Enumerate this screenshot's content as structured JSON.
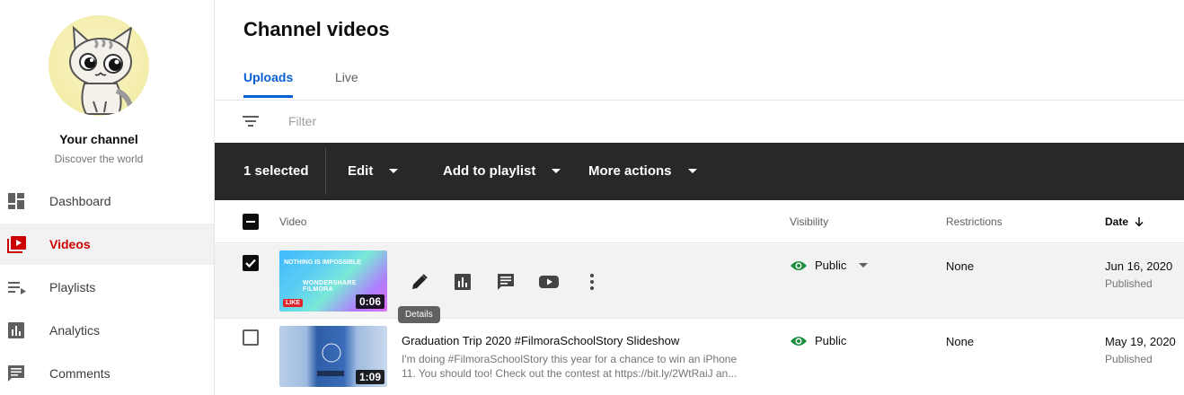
{
  "sidebar": {
    "channel_name": "Your channel",
    "channel_tagline": "Discover the world",
    "items": [
      {
        "label": "Dashboard",
        "icon": "dashboard-icon"
      },
      {
        "label": "Videos",
        "icon": "videos-icon",
        "active": true
      },
      {
        "label": "Playlists",
        "icon": "playlists-icon"
      },
      {
        "label": "Analytics",
        "icon": "analytics-icon"
      },
      {
        "label": "Comments",
        "icon": "comments-icon"
      }
    ]
  },
  "main": {
    "title": "Channel videos",
    "tabs": [
      {
        "label": "Uploads",
        "active": true
      },
      {
        "label": "Live"
      }
    ],
    "filter": {
      "placeholder": "Filter"
    }
  },
  "actionbar": {
    "selected_label": "1 selected",
    "edit_label": "Edit",
    "add_to_playlist_label": "Add to playlist",
    "more_actions_label": "More actions"
  },
  "table": {
    "headers": {
      "video": "Video",
      "visibility": "Visibility",
      "restrictions": "Restrictions",
      "date": "Date"
    },
    "rows": [
      {
        "checked": true,
        "thumb_text_top": "NOTHING IS IMPOSSIBLE",
        "thumb_text_mid": "WONDERSHARE FILMORA",
        "thumb_badge": "LIKE",
        "duration": "0:06",
        "tooltip": "Details",
        "visibility": "Public",
        "restrictions": "None",
        "date": "Jun 16, 2020",
        "status": "Published"
      },
      {
        "checked": false,
        "title": "Graduation Trip 2020 #FilmoraSchoolStory Slideshow",
        "description": "I'm doing #FilmoraSchoolStory this year for a chance to win an iPhone 11. You should too! Check out the contest at https://bit.ly/2WtRaiJ an...",
        "duration": "1:09",
        "visibility": "Public",
        "restrictions": "None",
        "date": "May 19, 2020",
        "status": "Published"
      }
    ]
  },
  "colors": {
    "accent": "#065fd4",
    "active_nav": "#cc0000",
    "actionbar_bg": "#282828",
    "public_green": "#1e8e3e"
  }
}
